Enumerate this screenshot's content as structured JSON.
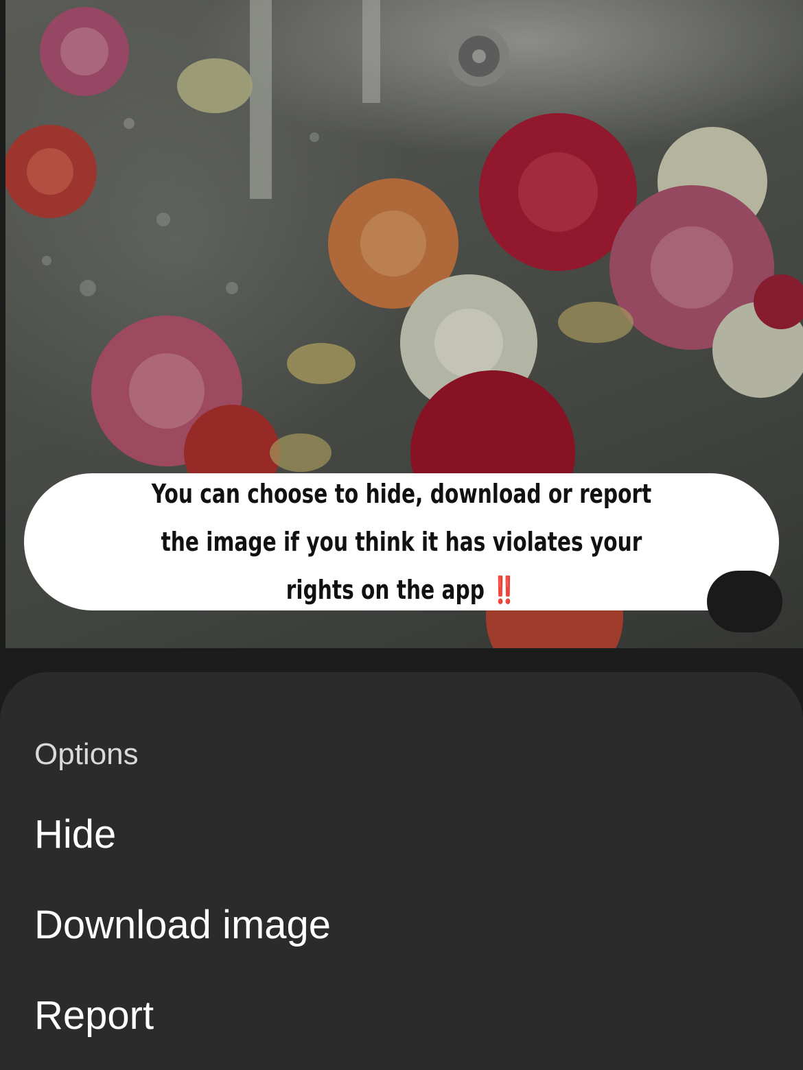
{
  "caption": {
    "text": "You can choose to hide, download or report the image if you think it has violates your rights on the app",
    "emoji": "‼️"
  },
  "options_sheet": {
    "title": "Options",
    "items": [
      {
        "label": "Hide"
      },
      {
        "label": "Download image"
      },
      {
        "label": "Report"
      }
    ]
  },
  "icons": {
    "corner_button": "lens-icon",
    "flowers": "rose-flower"
  },
  "colors": {
    "sheet_background": "#2b2b2b",
    "page_background": "#1c1c1c",
    "emoji_red": "#e0201c"
  }
}
